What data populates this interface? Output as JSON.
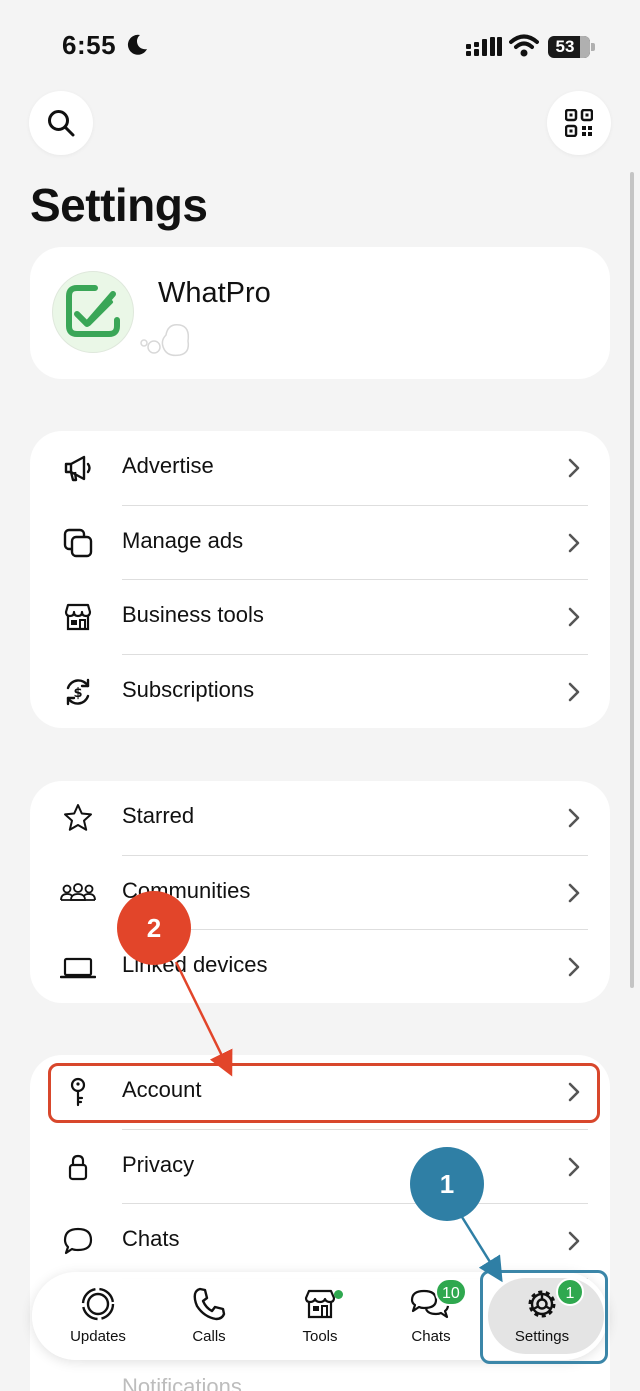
{
  "status_bar": {
    "time": "6:55",
    "battery": "53"
  },
  "header": {
    "title": "Settings"
  },
  "profile": {
    "name": "WhatPro"
  },
  "groups": {
    "business": [
      {
        "label": "Advertise",
        "icon": "megaphone-icon"
      },
      {
        "label": "Manage ads",
        "icon": "copy-icon"
      },
      {
        "label": "Business tools",
        "icon": "store-icon"
      },
      {
        "label": "Subscriptions",
        "icon": "subscription-icon"
      }
    ],
    "general": [
      {
        "label": "Starred",
        "icon": "star-icon"
      },
      {
        "label": "Communities",
        "icon": "communities-icon"
      },
      {
        "label": "Linked devices",
        "icon": "laptop-icon"
      }
    ],
    "account": [
      {
        "label": "Account",
        "icon": "key-icon"
      },
      {
        "label": "Privacy",
        "icon": "lock-icon"
      },
      {
        "label": "Chats",
        "icon": "chat-bubble-icon"
      },
      {
        "label": "Notifications",
        "icon": "notification-icon"
      }
    ]
  },
  "tabbar": {
    "tabs": [
      {
        "label": "Updates",
        "icon": "updates-icon"
      },
      {
        "label": "Calls",
        "icon": "phone-icon"
      },
      {
        "label": "Tools",
        "icon": "tools-icon"
      },
      {
        "label": "Chats",
        "icon": "chats-icon",
        "badge": "10"
      },
      {
        "label": "Settings",
        "icon": "gear-icon",
        "badge": "1",
        "active": true
      }
    ]
  },
  "annotations": {
    "step1": "1",
    "step2": "2"
  },
  "colors": {
    "accent_green": "#2fa84f",
    "annotation_red": "#e2452a",
    "annotation_blue": "#2f7fa5"
  }
}
